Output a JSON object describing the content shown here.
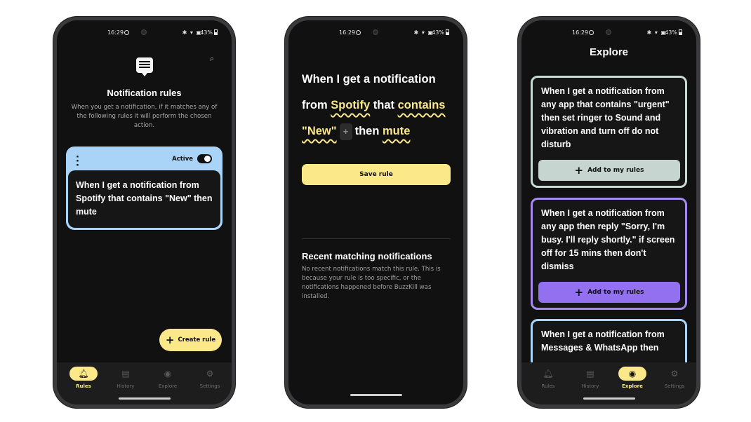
{
  "status": {
    "time": "16:29",
    "icons": "✱ ▾ ▣",
    "battery": "43%"
  },
  "nav": {
    "items": [
      {
        "label": "Rules",
        "icon": "bell-icon",
        "glyph": "🔔"
      },
      {
        "label": "History",
        "icon": "history-icon",
        "glyph": "▤"
      },
      {
        "label": "Explore",
        "icon": "compass-icon",
        "glyph": "◉"
      },
      {
        "label": "Settings",
        "icon": "gears-icon",
        "glyph": "⚙"
      }
    ]
  },
  "rules_screen": {
    "title": "Notification rules",
    "subtitle": "When you get a notification, if it matches any of the following rules it will perform the chosen action.",
    "rule": {
      "active_label": "Active",
      "active": true,
      "text": "When I get a notification from Spotify that contains \"New\" then mute"
    },
    "fab_label": "Create rule"
  },
  "editor_screen": {
    "line1": "When I get a notification",
    "from_word": "from",
    "app": "Spotify",
    "that_word": "that",
    "condition": "contains",
    "keyword": "\"New\"",
    "then_word": "then",
    "action": "mute",
    "save_label": "Save rule",
    "recent_title": "Recent matching notifications",
    "recent_body": "No recent notifications match this rule. This is because your rule is too specific, or the notifications happened before BuzzKill was installed."
  },
  "explore_screen": {
    "title": "Explore",
    "cards": [
      {
        "text": "When I get a notification from any app that contains \"urgent\" then set ringer to Sound and vibration and turn off do not disturb",
        "button": "Add to my rules"
      },
      {
        "text": "When I get a notification from any app then reply \"Sorry, I'm busy. I'll reply shortly.\" if screen off for 15 mins then don't dismiss",
        "button": "Add to my rules"
      },
      {
        "text": "When I get a notification from Messages & WhatsApp then"
      }
    ]
  },
  "colors": {
    "accent": "#fbe889",
    "rule_blue": "#a9d3f7",
    "purple": "#9370f0",
    "sage": "#c6d5d0"
  }
}
